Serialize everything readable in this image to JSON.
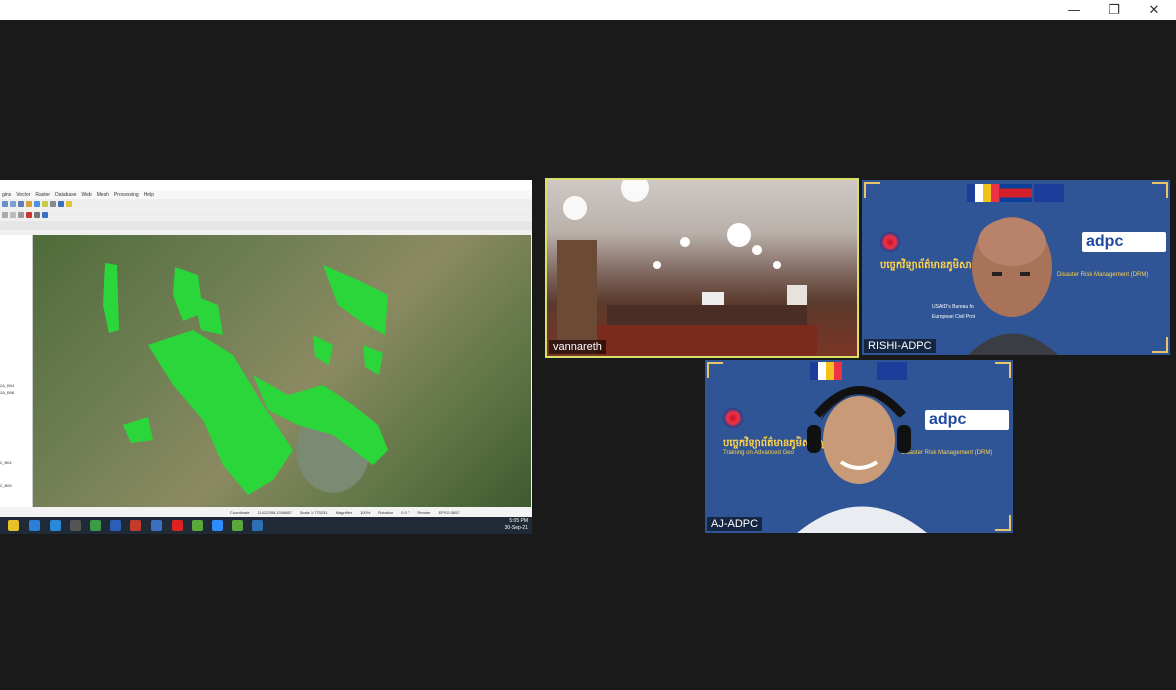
{
  "window": {
    "minimize_icon": "minimize-icon",
    "restore_icon": "restore-icon",
    "close_icon": "close-icon",
    "minimize_glyph": "—",
    "restore_glyph": "❐",
    "close_glyph": "✕"
  },
  "qgis": {
    "menus": [
      "gins",
      "Vector",
      "Raster",
      "Database",
      "Web",
      "Mesh",
      "Processing",
      "Help"
    ],
    "layer_labels": [
      "2A_B04",
      "2A_B08",
      "2_B04",
      "2_B05"
    ],
    "status": {
      "coordinate_label": "Coordinate",
      "coordinate_value": "11422398,1306887",
      "scale_label": "Scale 1:770251",
      "magnifier_label": "Magnifier",
      "magnifier_value": "100%",
      "rotation_label": "Rotation",
      "rotation_value": "0.0 °",
      "render_label": "Render",
      "crs": "EPSG:3857"
    },
    "clock_time": "5:05 PM",
    "clock_date": "30-Sep-21"
  },
  "participants": {
    "vannareth": {
      "name": "vannareth",
      "active_speaker_color": "#d8e06a"
    },
    "rishi": {
      "name": "RISHI-ADPC"
    },
    "aj": {
      "name": "AJ-ADPC"
    }
  },
  "banner": {
    "khmer_title": "បច្ចេកវិទ្យាព័ត៌មានភូមិសាស្ត្រ",
    "training_text": "Training on Advanced Geo",
    "drm_text": "Disaster Risk Management (DRM)",
    "org": "adpc",
    "usaid_text": "USAID's Bureau fo",
    "echo_text": "European Civil Prot"
  },
  "colors": {
    "background": "#1a1a1a",
    "banner_blue": "#2f5596",
    "flood_green": "#2bd63a"
  }
}
